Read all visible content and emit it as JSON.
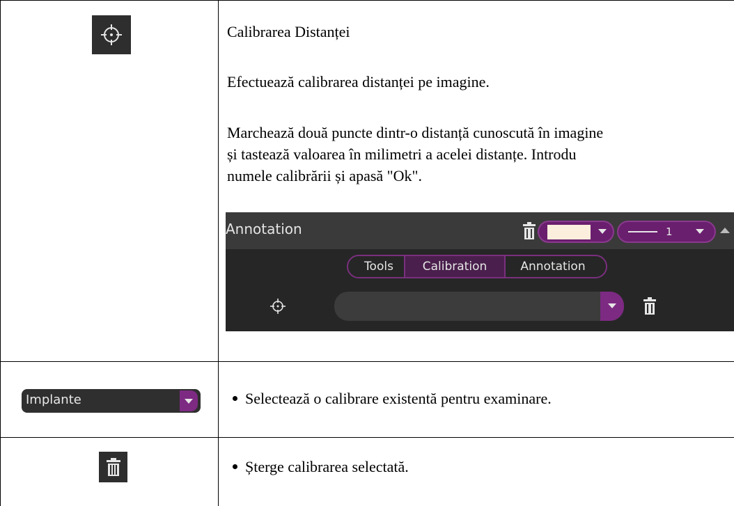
{
  "rows": [
    {
      "icon": "crosshair-icon",
      "title": "Calibrarea Distanței",
      "description": "Efectuează calibrarea distanței pe imagine.",
      "instructions": [
        "Marchează două puncte dintr-o distanță cunoscută în imagine",
        "și tastează valoarea în milimetri a acelei distanțe. Introdu",
        "numele calibrării și apasă \"Ok\"."
      ]
    },
    {
      "control_label": "Implante",
      "bullet": "Selectează o calibrare existentă pentru examinare."
    },
    {
      "icon": "trash-icon",
      "bullet": "Șterge calibrarea selectată."
    }
  ],
  "panel": {
    "title": "Annotation",
    "color_swatch": "#fbeedd",
    "line_width": "1",
    "tabs": [
      "Tools",
      "Calibration",
      "Annotation"
    ],
    "active_tab": "Calibration",
    "accent": "#7d2a83"
  }
}
